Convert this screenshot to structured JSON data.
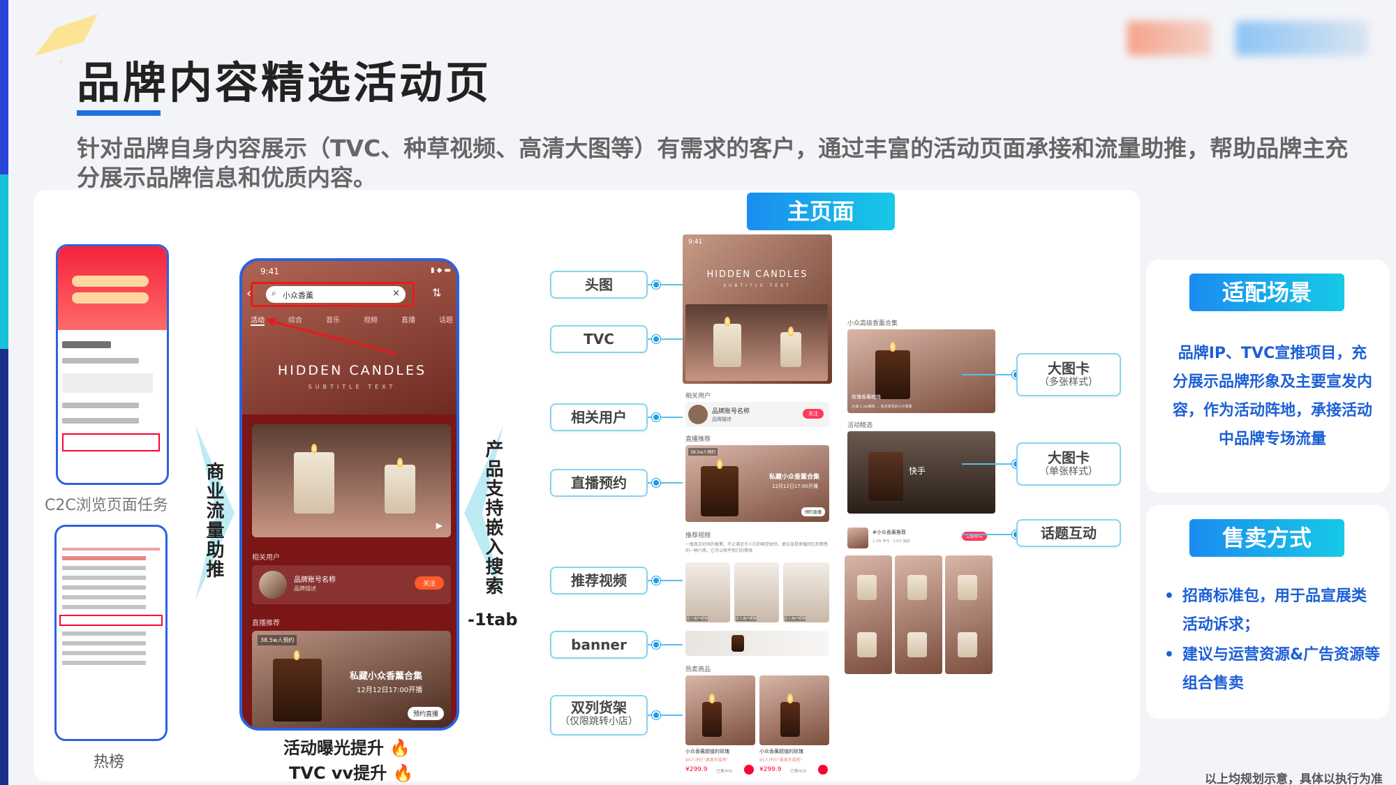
{
  "header": {
    "title": "品牌内容精选活动页",
    "description": "针对品牌自身内容展示（TVC、种草视频、高清大图等）有需求的客户，通过丰富的活动页面承接和流量助推，帮助品牌主充分展示品牌信息和优质内容。"
  },
  "main": {
    "main_page_label": "主页面",
    "left_captions": {
      "c2c": "C2C浏览页面任务",
      "hot": "热榜"
    },
    "vertical_left": "商业流量助推",
    "vertical_right": "产品支持嵌入搜索",
    "vertical_right_suffix": "-1tab",
    "bottom_lines": [
      "活动曝光提升",
      "TVC vv提升"
    ],
    "phone": {
      "time": "9:41",
      "search_text": "小众香薰",
      "tabs": [
        "活动",
        "综合",
        "音乐",
        "视频",
        "直播",
        "话题"
      ],
      "hero_title": "HIDDEN CANDLES",
      "hero_subtitle": "SUBTITLE TEXT",
      "related_user_label": "相关用户",
      "user_name": "品牌账号名称",
      "user_desc": "品牌描述",
      "follow": "关注",
      "live_label": "直播推荐",
      "live_badge": "38.5w人预约",
      "live_title": "私藏小众香薰合集",
      "live_time": "12月12日17:00开播",
      "live_btn": "预约直播"
    },
    "tags_left": [
      {
        "label": "头图"
      },
      {
        "label": "TVC"
      },
      {
        "label": "相关用户"
      },
      {
        "label": "直播预约"
      },
      {
        "label": "推荐视频"
      },
      {
        "label": "banner"
      },
      {
        "label": "双列货架",
        "sub": "（仅限跳转小店）"
      }
    ],
    "tags_right": [
      {
        "label": "大图卡",
        "sub": "（多张样式）"
      },
      {
        "label": "大图卡",
        "sub": "（单张样式）"
      },
      {
        "label": "话题互动"
      }
    ],
    "screen1": {
      "time": "9:41",
      "hero_title": "HIDDEN CANDLES",
      "hero_subtitle": "SUBTITLE TEXT",
      "related": "相关用户",
      "user": "品牌账号名称",
      "user_desc": "品牌描述",
      "follow": "关注",
      "live": "直播推荐",
      "live_badge": "38.5w人预约",
      "live_title": "私藏小众香薰合集",
      "live_time": "12月12日17:00开播",
      "live_btn": "预约直播",
      "rec": "推荐视频",
      "rec_text": "一瓶真正好闻的香薰，不止满足于人们的嗅觉体验，更应该是承载回忆和情感的一种介质。它可以唤平我们的情绪",
      "rec_user": "达人用户昵称",
      "hot": "热卖商品",
      "product_name": "小众香薰超值的玫瑰",
      "product_review": "90人评价\"满满幸福感\"",
      "price": "¥299.9",
      "sold": "已售400"
    },
    "screen2": {
      "card_title": "小众高级香薰合集",
      "card_caption": "玫瑰香薰蜡烛",
      "card_sub": "大海·1.2w播放 ... 有点意思的小众香薰",
      "activity_label": "活动精选",
      "kuaishou": "快手",
      "topic": "#小众香薰推荐",
      "topic_sub": "2.3W 参与 · 3.6亿 播放",
      "join": "立即参与"
    }
  },
  "side": {
    "card1": {
      "title": "适配场景",
      "body": "品牌IP、TVC宣推项目，充分展示品牌形象及主要宣发内容，作为活动阵地，承接活动中品牌专场流量"
    },
    "card2": {
      "title": "售卖方式",
      "items": [
        "招商标准包，用于品宣展类活动诉求；",
        "建议与运营资源&广告资源等组合售卖"
      ]
    }
  },
  "footer_note": "以上均规划示意，具体以执行为准"
}
